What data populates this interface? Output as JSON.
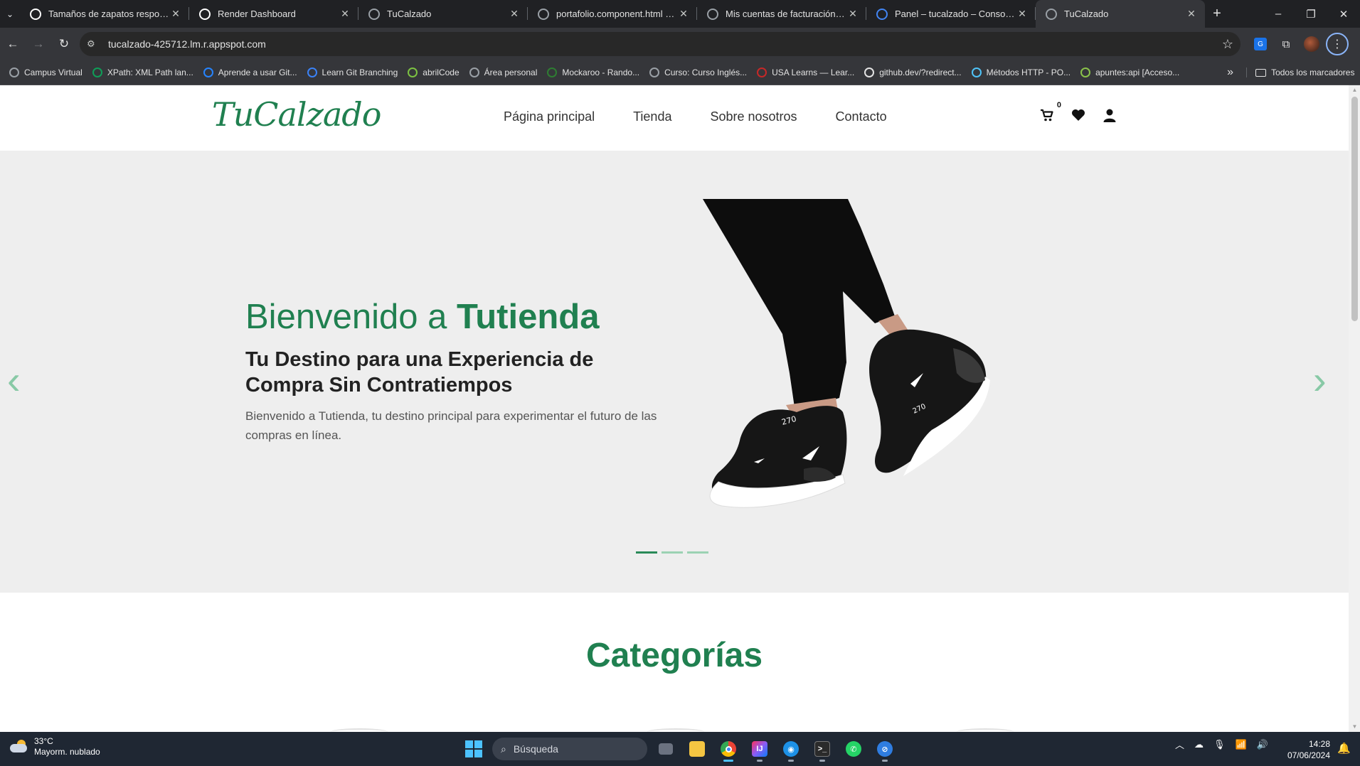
{
  "browser": {
    "tabs": [
      {
        "title": "Tamaños de zapatos responsivos",
        "icon": "openai-icon",
        "color": "#ffffff"
      },
      {
        "title": "Render Dashboard",
        "icon": "render-icon",
        "color": "#ffffff"
      },
      {
        "title": "TuCalzado",
        "icon": "globe-icon",
        "color": "#9aa0a6"
      },
      {
        "title": "portafolio.component.html - m",
        "icon": "github-icon",
        "color": "#9aa0a6"
      },
      {
        "title": "Mis cuentas de facturación – Fa",
        "icon": "settings-icon",
        "color": "#9aa0a6"
      },
      {
        "title": "Panel – tucalzado – Consola de",
        "icon": "cloud-console-icon",
        "color": "#4285f4"
      },
      {
        "title": "TuCalzado",
        "icon": "globe-icon",
        "color": "#9aa0a6",
        "active": true
      }
    ],
    "url": "tucalzado-425712.lm.r.appspot.com",
    "bookmarks": [
      {
        "label": "Campus Virtual",
        "icon": "globe-icon",
        "color": "#9aa0a6"
      },
      {
        "label": "XPath: XML Path lan...",
        "icon": "code-icon",
        "color": "#0f9d58"
      },
      {
        "label": "Aprende a usar Git...",
        "icon": "atlassian-icon",
        "color": "#2684ff"
      },
      {
        "label": "Learn Git Branching",
        "icon": "git-icon",
        "color": "#3b82f6"
      },
      {
        "label": "abrilCode",
        "icon": "leaf-icon",
        "color": "#7cc242"
      },
      {
        "label": "Área personal",
        "icon": "globe-icon",
        "color": "#9aa0a6"
      },
      {
        "label": "Mockaroo - Rando...",
        "icon": "mockaroo-icon",
        "color": "#2e7d32"
      },
      {
        "label": "Curso: Curso Inglés...",
        "icon": "globe-icon",
        "color": "#9aa0a6"
      },
      {
        "label": "USA Learns — Lear...",
        "icon": "star-icon",
        "color": "#c62828"
      },
      {
        "label": "github.dev/?redirect...",
        "icon": "github-icon",
        "color": "#e3e3e3"
      },
      {
        "label": "Métodos HTTP - PO...",
        "icon": "mdn-icon",
        "color": "#4fc3f7"
      },
      {
        "label": "apuntes:api [Acceso...",
        "icon": "doc-icon",
        "color": "#8bc34a"
      }
    ],
    "all_bookmarks": "Todos los marcadores"
  },
  "site": {
    "logo": "TuCalzado",
    "nav": [
      "Página principal",
      "Tienda",
      "Sobre nosotros",
      "Contacto"
    ],
    "cart_count": "0",
    "hero": {
      "title_light": "Bienvenido a ",
      "title_bold": "Tutienda",
      "subtitle": "Tu Destino para una Experiencia de Compra Sin Contratiempos",
      "description": "Bienvenido a Tutienda, tu destino principal para experimentar el futuro de las compras en línea.",
      "slides": 3,
      "active_slide": 1
    },
    "categories_title": "Categorías",
    "colors": {
      "brand": "#208050",
      "hero_bg": "#eeeeee"
    }
  },
  "taskbar": {
    "temperature": "33°C",
    "weather": "Mayorm. nublado",
    "search_placeholder": "Búsqueda",
    "time": "14:28",
    "date": "07/06/2024"
  }
}
